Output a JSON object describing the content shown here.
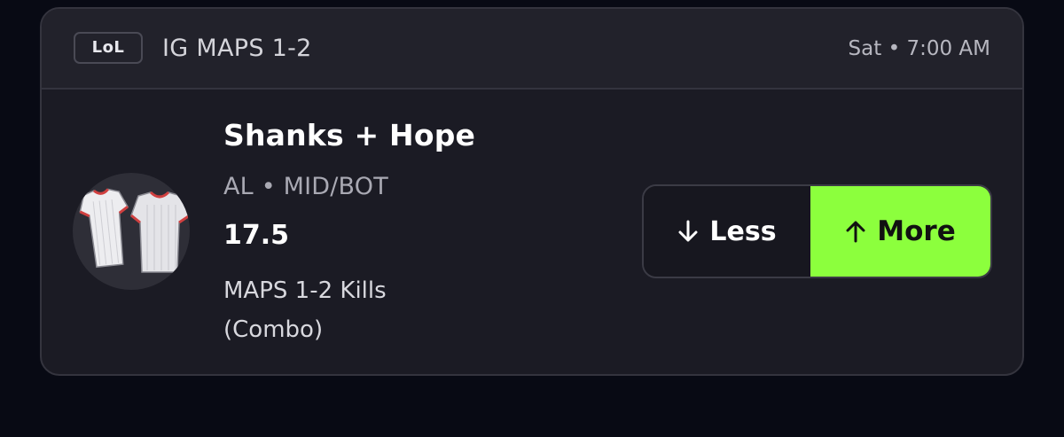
{
  "card": {
    "league": "LoL",
    "match_title": "IG MAPS 1-2",
    "time": "Sat • 7:00 AM"
  },
  "player": {
    "name": "Shanks + Hope",
    "meta": "AL • MID/BOT",
    "line": "17.5",
    "stat_line1": "MAPS 1-2 Kills",
    "stat_line2": "(Combo)",
    "avatar_icon": "jersey-icon"
  },
  "picks": {
    "less_label": "Less",
    "less_icon": "arrow-down-icon",
    "more_label": "More",
    "more_icon": "arrow-up-icon",
    "more_selected": true
  },
  "colors": {
    "background": "#080a14",
    "card": "#1b1b24",
    "header": "#22222b",
    "accent": "#8cff3d"
  }
}
